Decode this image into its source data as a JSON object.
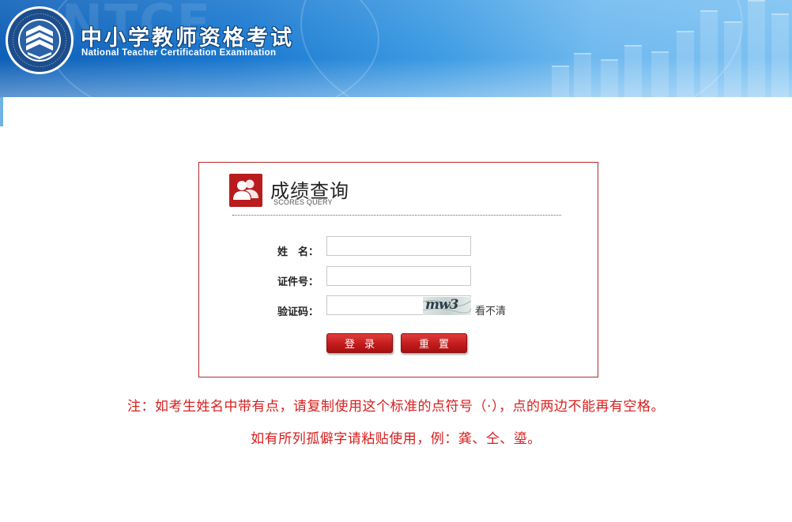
{
  "header": {
    "logo_text": "教师资格考试 National Teacher Certification Examination",
    "title_cn": "中小学教师资格考试",
    "title_en": "National Teacher Certification Examination"
  },
  "panel": {
    "title": "成绩查询",
    "subtitle": "SCORES QUERY",
    "name_label": "姓　名：",
    "name_value": "",
    "id_label": "证件号：",
    "id_value": "",
    "captcha_label": "验证码：",
    "captcha_value": "",
    "captcha_image_text": "mw3",
    "refresh_link": "看不清",
    "login_button": "登录",
    "reset_button": "重置"
  },
  "notes": {
    "line1": "注：如考生姓名中带有点，请复制使用这个标准的点符号（·），点的两边不能再有空格。",
    "line2": "如有所列孤僻字请粘贴使用，例：龚、仝、瑬。"
  },
  "colors": {
    "accent_red": "#b81c1c",
    "note_red": "#d81e1e",
    "header_blue": "#1a78cf"
  },
  "icons": {
    "panel_icon": "users-icon"
  }
}
